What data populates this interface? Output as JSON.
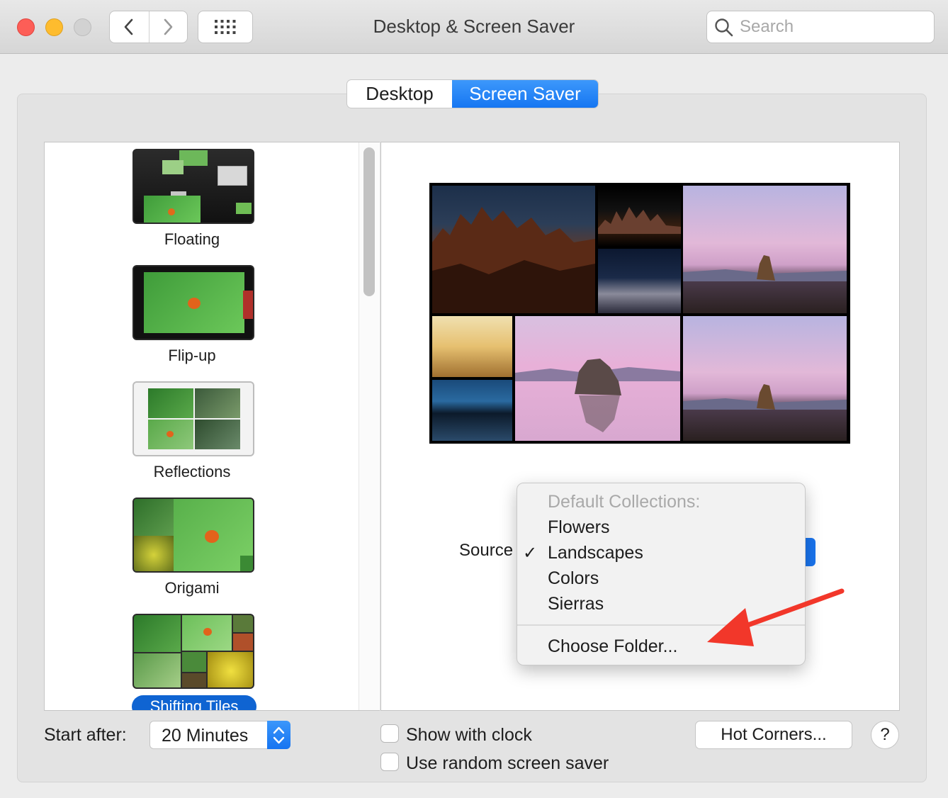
{
  "window": {
    "title": "Desktop & Screen Saver"
  },
  "search": {
    "placeholder": "Search"
  },
  "tabs": [
    {
      "label": "Desktop"
    },
    {
      "label": "Screen Saver"
    }
  ],
  "savers": [
    {
      "label": "Floating"
    },
    {
      "label": "Flip-up"
    },
    {
      "label": "Reflections"
    },
    {
      "label": "Origami"
    },
    {
      "label": "Shifting Tiles"
    }
  ],
  "source": {
    "label": "Source",
    "menu": {
      "header": "Default Collections:",
      "items": [
        "Flowers",
        "Landscapes",
        "Colors",
        "Sierras"
      ],
      "selected": "Landscapes",
      "choose_folder": "Choose Folder..."
    }
  },
  "start_after": {
    "label": "Start after:",
    "value": "20 Minutes"
  },
  "options": {
    "show_clock": "Show with clock",
    "random_saver": "Use random screen saver"
  },
  "buttons": {
    "hot_corners": "Hot Corners...",
    "help": "?"
  },
  "colors": {
    "accent": "#1676f2",
    "selected_label": "#0f64d2",
    "arrow": "#f2372a"
  }
}
